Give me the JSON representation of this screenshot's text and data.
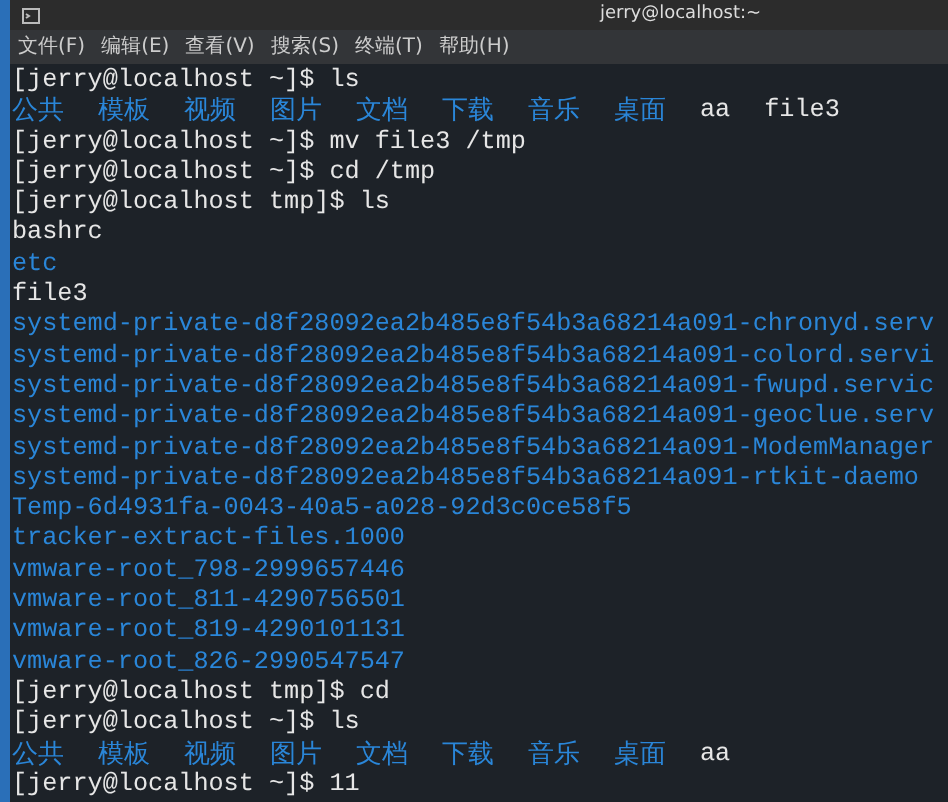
{
  "window": {
    "title": "jerry@localhost:~"
  },
  "menu": [
    "文件(F)",
    "编辑(E)",
    "查看(V)",
    "搜索(S)",
    "终端(T)",
    "帮助(H)"
  ],
  "lines": [
    {
      "kind": "prompt",
      "text": "[jerry@localhost ~]$ ls"
    },
    {
      "kind": "listing",
      "entries": [
        {
          "text": "公共",
          "kind": "dir"
        },
        {
          "text": "模板",
          "kind": "dir"
        },
        {
          "text": "视频",
          "kind": "dir"
        },
        {
          "text": "图片",
          "kind": "dir"
        },
        {
          "text": "文档",
          "kind": "dir"
        },
        {
          "text": "下载",
          "kind": "dir"
        },
        {
          "text": "音乐",
          "kind": "dir"
        },
        {
          "text": "桌面",
          "kind": "dir"
        },
        {
          "text": "aa",
          "kind": "file"
        },
        {
          "text": "file3",
          "kind": "file"
        }
      ]
    },
    {
      "kind": "prompt",
      "text": "[jerry@localhost ~]$ mv file3 /tmp"
    },
    {
      "kind": "prompt",
      "text": "[jerry@localhost ~]$ cd /tmp"
    },
    {
      "kind": "prompt",
      "text": "[jerry@localhost tmp]$ ls"
    },
    {
      "kind": "listing",
      "entries": [
        {
          "text": "bashrc",
          "kind": "file"
        }
      ]
    },
    {
      "kind": "listing",
      "entries": [
        {
          "text": "etc",
          "kind": "dir"
        }
      ]
    },
    {
      "kind": "listing",
      "entries": [
        {
          "text": "file3",
          "kind": "file"
        }
      ]
    },
    {
      "kind": "listing",
      "entries": [
        {
          "text": "systemd-private-d8f28092ea2b485e8f54b3a68214a091-chronyd.serv",
          "kind": "dir"
        }
      ]
    },
    {
      "kind": "listing",
      "entries": [
        {
          "text": "systemd-private-d8f28092ea2b485e8f54b3a68214a091-colord.servi",
          "kind": "dir"
        }
      ]
    },
    {
      "kind": "listing",
      "entries": [
        {
          "text": "systemd-private-d8f28092ea2b485e8f54b3a68214a091-fwupd.servic",
          "kind": "dir"
        }
      ]
    },
    {
      "kind": "listing",
      "entries": [
        {
          "text": "systemd-private-d8f28092ea2b485e8f54b3a68214a091-geoclue.serv",
          "kind": "dir"
        }
      ]
    },
    {
      "kind": "listing",
      "entries": [
        {
          "text": "systemd-private-d8f28092ea2b485e8f54b3a68214a091-ModemManager",
          "kind": "dir"
        }
      ]
    },
    {
      "kind": "listing",
      "entries": [
        {
          "text": "systemd-private-d8f28092ea2b485e8f54b3a68214a091-rtkit-daemo",
          "kind": "dir"
        }
      ]
    },
    {
      "kind": "listing",
      "entries": [
        {
          "text": "Temp-6d4931fa-0043-40a5-a028-92d3c0ce58f5",
          "kind": "dir"
        }
      ]
    },
    {
      "kind": "listing",
      "entries": [
        {
          "text": "tracker-extract-files.1000",
          "kind": "dir"
        }
      ]
    },
    {
      "kind": "listing",
      "entries": [
        {
          "text": "vmware-root_798-2999657446",
          "kind": "dir"
        }
      ]
    },
    {
      "kind": "listing",
      "entries": [
        {
          "text": "vmware-root_811-4290756501",
          "kind": "dir"
        }
      ]
    },
    {
      "kind": "listing",
      "entries": [
        {
          "text": "vmware-root_819-4290101131",
          "kind": "dir"
        }
      ]
    },
    {
      "kind": "listing",
      "entries": [
        {
          "text": "vmware-root_826-2990547547",
          "kind": "dir"
        }
      ]
    },
    {
      "kind": "prompt",
      "text": "[jerry@localhost tmp]$ cd"
    },
    {
      "kind": "prompt",
      "text": "[jerry@localhost ~]$ ls"
    },
    {
      "kind": "listing",
      "entries": [
        {
          "text": "公共",
          "kind": "dir"
        },
        {
          "text": "模板",
          "kind": "dir"
        },
        {
          "text": "视频",
          "kind": "dir"
        },
        {
          "text": "图片",
          "kind": "dir"
        },
        {
          "text": "文档",
          "kind": "dir"
        },
        {
          "text": "下载",
          "kind": "dir"
        },
        {
          "text": "音乐",
          "kind": "dir"
        },
        {
          "text": "桌面",
          "kind": "dir"
        },
        {
          "text": "aa",
          "kind": "file"
        }
      ]
    },
    {
      "kind": "prompt",
      "text": "[jerry@localhost ~]$ 11"
    }
  ]
}
